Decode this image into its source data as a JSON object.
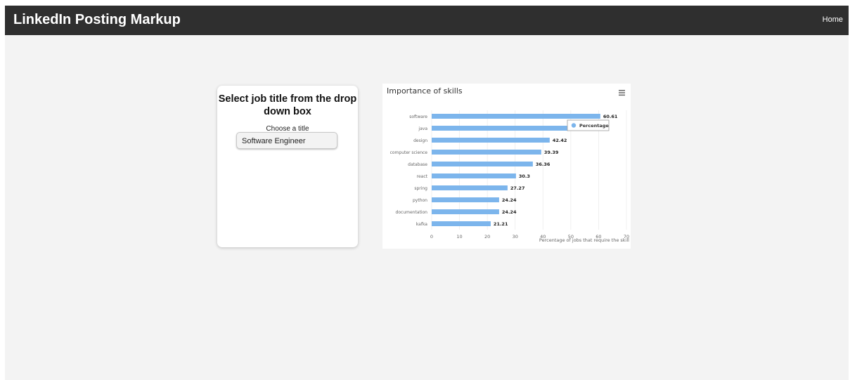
{
  "navbar": {
    "brand": "LinkedIn Posting Markup",
    "home_link": "Home"
  },
  "selector_card": {
    "title": "Select job title from the drop down box",
    "choose_label": "Choose a title",
    "selected_value": "Software Engineer"
  },
  "chart_data": {
    "type": "bar",
    "orientation": "horizontal",
    "title": "Importance of skills",
    "xlabel": "Percentage of jobs that require the skill",
    "ylabel": "",
    "categories": [
      "software",
      "java",
      "design",
      "computer science",
      "database",
      "react",
      "spring",
      "python",
      "documentation",
      "kafka"
    ],
    "series": [
      {
        "name": "Percentage",
        "values": [
          60.61,
          51.52,
          42.42,
          39.39,
          36.36,
          30.3,
          27.27,
          24.24,
          24.24,
          21.21
        ],
        "data_labels": [
          "60.61",
          "",
          "42.42",
          "39.39",
          "36.36",
          "30.3",
          "27.27",
          "24.24",
          "24.24",
          "21.21"
        ]
      }
    ],
    "xlim": [
      0,
      70
    ],
    "xticks": [
      0,
      10,
      20,
      30,
      40,
      50,
      60,
      70
    ],
    "grid": true,
    "legend": "tooltip-style box, top-right",
    "bar_color": "#7cb5ec",
    "menu_icon": "hamburger-menu-icon"
  }
}
